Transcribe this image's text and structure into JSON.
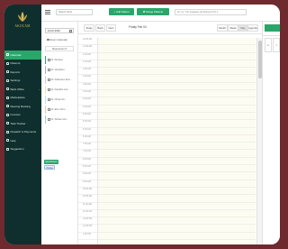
{
  "brand": {
    "logo_text": "AKOCAM",
    "accent": "#2aa66b",
    "sidebar_bg": "#0e2f2d",
    "gold": "#d6b85a"
  },
  "topbar": {
    "search_placeholder": "Search client",
    "add_button": "Add Patient",
    "merge_button": "Merge Patients",
    "ticker": "for my: 'SG anagapin pie Rapport Pro.c'"
  },
  "sidebar": {
    "items": [
      {
        "label": "Calendar",
        "icon": "calendar-icon",
        "active": true
      },
      {
        "label": "Patients",
        "icon": "users-icon",
        "active": false
      },
      {
        "label": "Reports",
        "icon": "chart-icon",
        "active": false
      },
      {
        "label": "Settings",
        "icon": "gear-icon",
        "active": false
      },
      {
        "label": "Back Office",
        "icon": "briefcase-icon",
        "active": false,
        "caret": "›"
      },
      {
        "label": "Marketplace",
        "icon": "store-icon",
        "active": false
      },
      {
        "label": "Meeting Booking",
        "icon": "clock-icon",
        "active": false
      },
      {
        "label": "Invoices",
        "icon": "invoice-icon",
        "active": false
      },
      {
        "label": "Task Tracker",
        "icon": "task-icon",
        "active": false
      },
      {
        "label": "Dispatch & Payments",
        "icon": "dispatch-icon",
        "active": false
      },
      {
        "label": "Help",
        "icon": "help-icon",
        "active": false
      },
      {
        "label": "Suggestion",
        "icon": "suggestion-icon",
        "active": false
      }
    ]
  },
  "leftpanel": {
    "date": "14-02-2022",
    "zoom_label": "Zoom Calendar",
    "resources_label": "Resources ▾",
    "staff": [
      {
        "label": "Dr. Demeer",
        "color": "#2aa66b"
      },
      {
        "label": "Dr. Vendeset",
        "color": "#b6a8e0"
      },
      {
        "label": "Dr. Pathowen Ecm...",
        "color": "#f2c2d2"
      },
      {
        "label": "Dr. Dambhe Lite...",
        "color": "#f1e7a8"
      },
      {
        "label": "Dr. Orhan Alt...",
        "color": "#bfe2f0"
      },
      {
        "label": "Dr. Ehe Chrm...",
        "color": "#f3c9a5"
      },
      {
        "label": "Dr. Schaen Avi...",
        "color": "#9fd6c4"
      }
    ],
    "tag_appointment": "Appointment",
    "tag_holiday": "Holiday"
  },
  "calendar": {
    "today": "Today",
    "back": "Back",
    "next": "Next",
    "title": "Friday Feb 04",
    "views": [
      "Month",
      "Week",
      "Day",
      "Agenda"
    ],
    "active_view": "Day",
    "times": [
      "12:00 AM",
      "12:30 AM",
      "1:00 AM",
      "1:30 AM",
      "2:00 AM",
      "2:30 AM",
      "3:00 AM",
      "3:30 AM",
      "4:00 AM",
      "4:30 AM",
      "5:00 AM",
      "5:30 AM",
      "6:00 AM",
      "6:30 AM",
      "7:00 AM",
      "7:30 AM",
      "8:00 AM",
      "8:30 AM",
      "9:00 AM",
      "9:30 AM",
      "10:00 AM",
      "10:30 AM",
      "11:00 AM",
      "11:30 AM",
      "12:00 PM",
      "12:30 PM",
      "1:00 PM"
    ]
  },
  "rightpane": {
    "card_left": "1",
    "card_right": "4"
  }
}
